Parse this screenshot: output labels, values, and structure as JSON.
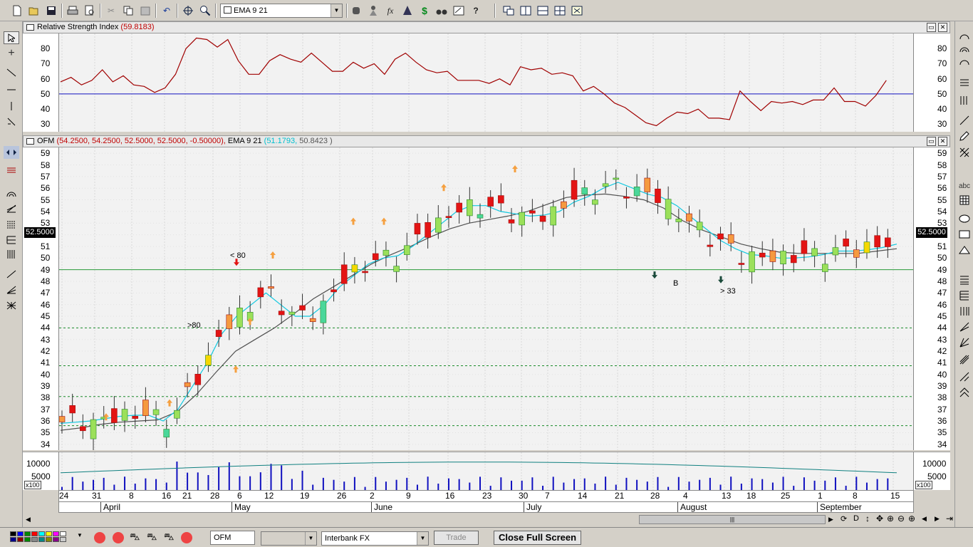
{
  "toolbar": {
    "indicator_combo": "EMA 9 21",
    "icons": [
      "new-icon",
      "open-icon",
      "save-icon",
      "print-icon",
      "print-preview-icon",
      "cut-icon",
      "copy-icon",
      "paste-icon",
      "undo-icon",
      "crosshair-icon",
      "zoom-icon",
      "indicator-icon",
      "alert-icon",
      "fx-icon",
      "tree-icon",
      "dollar-icon",
      "binoculars-icon",
      "edit-icon",
      "help-icon",
      "window-icon",
      "tile-vertical-icon",
      "tile-horizontal-icon",
      "grid-icon",
      "layout-icon"
    ]
  },
  "rsi": {
    "title": "Relative Strength Index",
    "value": "(59.8183)",
    "y_labels": [
      "80",
      "70",
      "60",
      "50",
      "40",
      "30"
    ],
    "ref_line": 50
  },
  "price": {
    "symbol": "OFM",
    "ohlc": "(54.2500, 54.2500, 52.5000, 52.5000, -0.50000),",
    "ema_label": "EMA 9 21",
    "ema_values_1": "(51.1793,",
    "ema_values_2": "50.8423 )",
    "last_price": "52.5000",
    "y_labels": [
      "59",
      "58",
      "57",
      "56",
      "55",
      "54",
      "53",
      "52",
      "51",
      "50",
      "49",
      "48",
      "47",
      "46",
      "45",
      "44",
      "43",
      "42",
      "41",
      "40",
      "39",
      "38",
      "37",
      "36",
      "35",
      "34"
    ],
    "annotations": [
      "< 80",
      ">80",
      "B",
      "> 33",
      "> 33"
    ],
    "h_line_solid": 49,
    "h_lines_dashed": [
      44,
      40.75,
      38.1,
      35.6
    ]
  },
  "volume": {
    "y_labels": [
      "10000",
      "5000"
    ],
    "scale": "x100"
  },
  "xaxis": {
    "days": [
      "24",
      "31",
      "8",
      "16",
      "21",
      "28",
      "6",
      "12",
      "19",
      "26",
      "2",
      "9",
      "16",
      "23",
      "30",
      "7",
      "14",
      "21",
      "28",
      "4",
      "13",
      "18",
      "25",
      "1",
      "8",
      "15"
    ],
    "months": [
      "April",
      "May",
      "June",
      "July",
      "August",
      "September"
    ]
  },
  "bottom": {
    "symbol_field": "OFM",
    "feed_combo": "Interbank FX",
    "trade_label": "Trade",
    "close_label": "Close Full Screen"
  },
  "chart_data": {
    "type": "candlestick",
    "title": "OFM",
    "series": [
      {
        "name": "RSI",
        "values": [
          58,
          61,
          56,
          59,
          66,
          58,
          62,
          56,
          55,
          51,
          54,
          63,
          80,
          87,
          86,
          81,
          86,
          72,
          63,
          63,
          72,
          76,
          73,
          71,
          77,
          71,
          65,
          65,
          71,
          67,
          70,
          63,
          73,
          77,
          71,
          66,
          64,
          65,
          59,
          59,
          59,
          57,
          60,
          56,
          68,
          66,
          67,
          63,
          64,
          62,
          52,
          55,
          50,
          44,
          41,
          36,
          31,
          29,
          34,
          38,
          37,
          40,
          34,
          34,
          33,
          52,
          45,
          39,
          45,
          44,
          45,
          43,
          46,
          46,
          54,
          45,
          45,
          42,
          49,
          59
        ]
      },
      {
        "name": "EMA 9",
        "values": [
          35.8,
          35.9,
          36.0,
          36.2,
          36.4,
          36.5,
          36.5,
          36.0,
          37.0,
          39.0,
          41.0,
          43.5,
          45.0,
          46.0,
          47.0,
          46.0,
          45.0,
          45.0,
          46.0,
          47.5,
          48.5,
          49.5,
          50.0,
          50.2,
          51.0,
          52.0,
          53.0,
          54.0,
          54.5,
          54.5,
          54.0,
          53.8,
          53.6,
          53.7,
          54.0,
          54.8,
          55.3,
          56.0,
          56.5,
          56.0,
          55.5,
          55.2,
          54.5,
          53.5,
          52.5,
          51.5,
          50.8,
          50.3,
          50.2,
          50.0,
          50.0,
          50.1,
          50.3,
          50.6,
          50.6,
          50.7,
          50.9,
          51.2
        ]
      },
      {
        "name": "EMA 21",
        "values": [
          35.2,
          35.4,
          35.7,
          35.9,
          36.0,
          36.1,
          36.8,
          38.3,
          40.2,
          42.0,
          43.0,
          44.0,
          45.2,
          46.5,
          47.5,
          48.5,
          49.5,
          50.3,
          51.0,
          51.8,
          52.5,
          53.0,
          53.3,
          53.6,
          54.0,
          54.6,
          55.2,
          55.4,
          55.5,
          55.3,
          55.0,
          54.3,
          53.2,
          52.4,
          51.8,
          51.2,
          50.8,
          50.5,
          50.4,
          50.4,
          50.4,
          50.4,
          50.6,
          50.8
        ]
      }
    ],
    "y_range": [
      33.5,
      59.5
    ],
    "rsi_range": [
      25,
      90
    ],
    "volume_range": [
      0,
      15000
    ]
  }
}
